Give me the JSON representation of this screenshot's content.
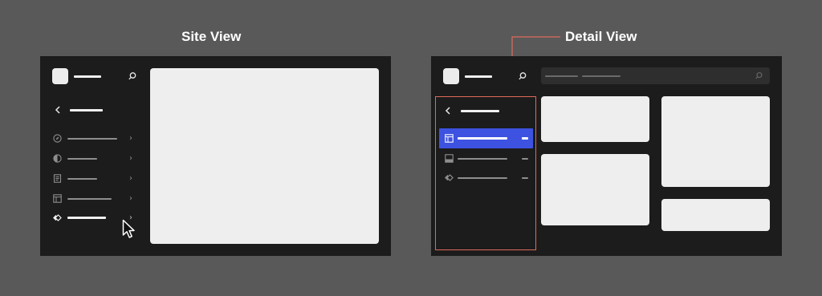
{
  "captions": {
    "site_view": "Site View",
    "detail_view": "Detail View"
  },
  "colors": {
    "background": "#595959",
    "panel": "#1c1c1c",
    "placeholder": "#eeeeee",
    "selection": "#3d52e0",
    "highlight": "#e06a5a"
  },
  "icons": {
    "site_nav": [
      "compass-icon",
      "contrast-icon",
      "page-icon",
      "layout-icon",
      "component-icon"
    ],
    "detail_nav": [
      "panel-icon",
      "image-icon",
      "component-icon"
    ],
    "other": [
      "search-icon",
      "back-arrow-icon",
      "mouse-cursor-icon"
    ]
  }
}
